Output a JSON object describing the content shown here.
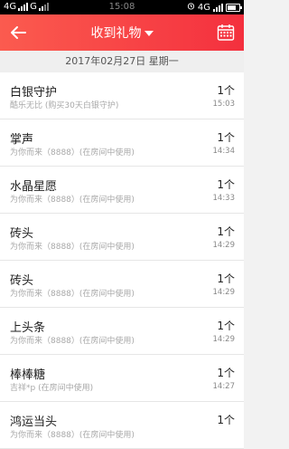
{
  "status_bar": {
    "left_text": "4G",
    "left_text2": "G",
    "time": "15:08",
    "right_text": "4G"
  },
  "appbar": {
    "title": "收到礼物",
    "background_start": "#fb5b4f",
    "background_end": "#f4303e"
  },
  "date_header": "2017年02月27日 星期一",
  "gifts": [
    {
      "name": "白银守护",
      "desc": "酷乐无比 (购买30天白银守护)",
      "count": "1个",
      "time": "15:03"
    },
    {
      "name": "掌声",
      "desc": "为你而来（8888）(在房间中使用)",
      "count": "1个",
      "time": "14:34"
    },
    {
      "name": "水晶星愿",
      "desc": "为你而来（8888）(在房间中使用)",
      "count": "1个",
      "time": "14:33"
    },
    {
      "name": "砖头",
      "desc": "为你而来（8888）(在房间中使用)",
      "count": "1个",
      "time": "14:29"
    },
    {
      "name": "砖头",
      "desc": "为你而来（8888）(在房间中使用)",
      "count": "1个",
      "time": "14:29"
    },
    {
      "name": "上头条",
      "desc": "为你而来（8888）(在房间中使用)",
      "count": "1个",
      "time": "14:29"
    },
    {
      "name": "棒棒糖",
      "desc": "吉祥*p (在房间中使用)",
      "count": "1个",
      "time": "14:27"
    },
    {
      "name": "鸿运当头",
      "desc": "为你而来（8888）(在房间中使用)",
      "count": "1个",
      "time": ""
    }
  ]
}
